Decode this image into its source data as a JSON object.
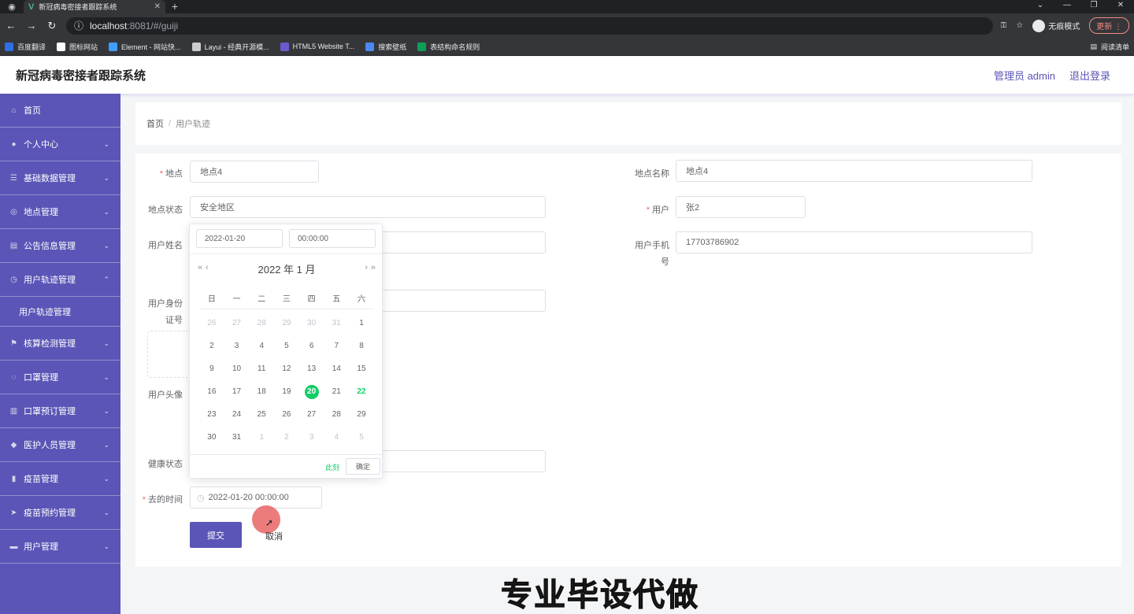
{
  "browser": {
    "tab_title": "新冠病毒密接者跟踪系统",
    "url_host": "localhost",
    "url_path": ":8081/#/guiji",
    "incognito_label": "无痕模式",
    "update_label": "更新",
    "bookmarks": [
      {
        "label": "百度翻译",
        "color": "#2f6fe4"
      },
      {
        "label": "图标网站",
        "color": "#ffffff"
      },
      {
        "label": "Element - 网站快...",
        "color": "#409eff"
      },
      {
        "label": "Layui - 经典开源模...",
        "color": "#cccccc"
      },
      {
        "label": "HTML5 Website T...",
        "color": "#6a5acd"
      },
      {
        "label": "搜索壁纸",
        "color": "#4a8af4"
      },
      {
        "label": "表结构命名规则",
        "color": "#0f9d58"
      }
    ],
    "reading_list_label": "阅读清单"
  },
  "header": {
    "title": "新冠病毒密接者跟踪系统",
    "admin_label": "管理员 admin",
    "logout_label": "退出登录"
  },
  "sidebar": {
    "items": [
      {
        "label": "首页",
        "icon": "home-icon",
        "glyph": "⌂",
        "chevron": ""
      },
      {
        "label": "个人中心",
        "icon": "user-icon",
        "glyph": "●",
        "chevron": "⌄"
      },
      {
        "label": "基础数据管理",
        "icon": "sliders-icon",
        "glyph": "☰",
        "chevron": "⌄"
      },
      {
        "label": "地点管理",
        "icon": "globe-icon",
        "glyph": "◎",
        "chevron": "⌄"
      },
      {
        "label": "公告信息管理",
        "icon": "bank-icon",
        "glyph": "▤",
        "chevron": "⌄"
      },
      {
        "label": "用户轨迹管理",
        "icon": "compass-icon",
        "glyph": "◷",
        "chevron": "⌃"
      }
    ],
    "sub_item": "用户轨迹管理",
    "items_after": [
      {
        "label": "核算检测管理",
        "icon": "flag-icon",
        "glyph": "⚑",
        "chevron": "⌄"
      },
      {
        "label": "口罩管理",
        "icon": "loading-icon",
        "glyph": "◌",
        "chevron": "⌄"
      },
      {
        "label": "口罩预订管理",
        "icon": "document-icon",
        "glyph": "▥",
        "chevron": "⌄"
      },
      {
        "label": "医护人员管理",
        "icon": "location-icon",
        "glyph": "◆",
        "chevron": "⌄"
      },
      {
        "label": "疫苗管理",
        "icon": "chart-icon",
        "glyph": "▮",
        "chevron": "⌄"
      },
      {
        "label": "疫苗预约管理",
        "icon": "send-icon",
        "glyph": "➤",
        "chevron": "⌄"
      },
      {
        "label": "用户管理",
        "icon": "card-icon",
        "glyph": "▬",
        "chevron": "⌄"
      }
    ]
  },
  "breadcrumb": {
    "home": "首页",
    "current": "用户轨迹"
  },
  "form": {
    "location_label": "地点",
    "location_value": "地点4",
    "location_name_label": "地点名称",
    "location_name_value": "地点4",
    "location_status_label": "地点状态",
    "location_status_value": "安全地区",
    "user_label": "用户",
    "user_value": "张2",
    "user_name_label": "用户姓名",
    "user_phone_label_1": "用户手机",
    "user_phone_label_2": "号",
    "user_phone_value": "17703786902",
    "user_id_label_1": "用户身份",
    "user_id_label_2": "证号",
    "user_avatar_label": "用户头像",
    "health_status_label": "健康状态",
    "time_label": "去的时间",
    "time_value": "2022-01-20 00:00:00",
    "submit_label": "提交",
    "cancel_label": "取消"
  },
  "datepicker": {
    "date_input": "2022-01-20",
    "time_input": "00:00:00",
    "title": "2022 年  1 月",
    "weekdays": [
      "日",
      "一",
      "二",
      "三",
      "四",
      "五",
      "六"
    ],
    "weeks": [
      [
        "26",
        "27",
        "28",
        "29",
        "30",
        "31",
        "1"
      ],
      [
        "2",
        "3",
        "4",
        "5",
        "6",
        "7",
        "8"
      ],
      [
        "9",
        "10",
        "11",
        "12",
        "13",
        "14",
        "15"
      ],
      [
        "16",
        "17",
        "18",
        "19",
        "20",
        "21",
        "22"
      ],
      [
        "23",
        "24",
        "25",
        "26",
        "27",
        "28",
        "29"
      ],
      [
        "30",
        "31",
        "1",
        "2",
        "3",
        "4",
        "5"
      ]
    ],
    "selected": "20",
    "today": "22",
    "now_label": "此刻",
    "ok_label": "确定"
  },
  "watermark": "专业毕设代做",
  "colors": {
    "accent": "#5a55b6",
    "success": "#13ce66",
    "required": "#f56c6c"
  }
}
